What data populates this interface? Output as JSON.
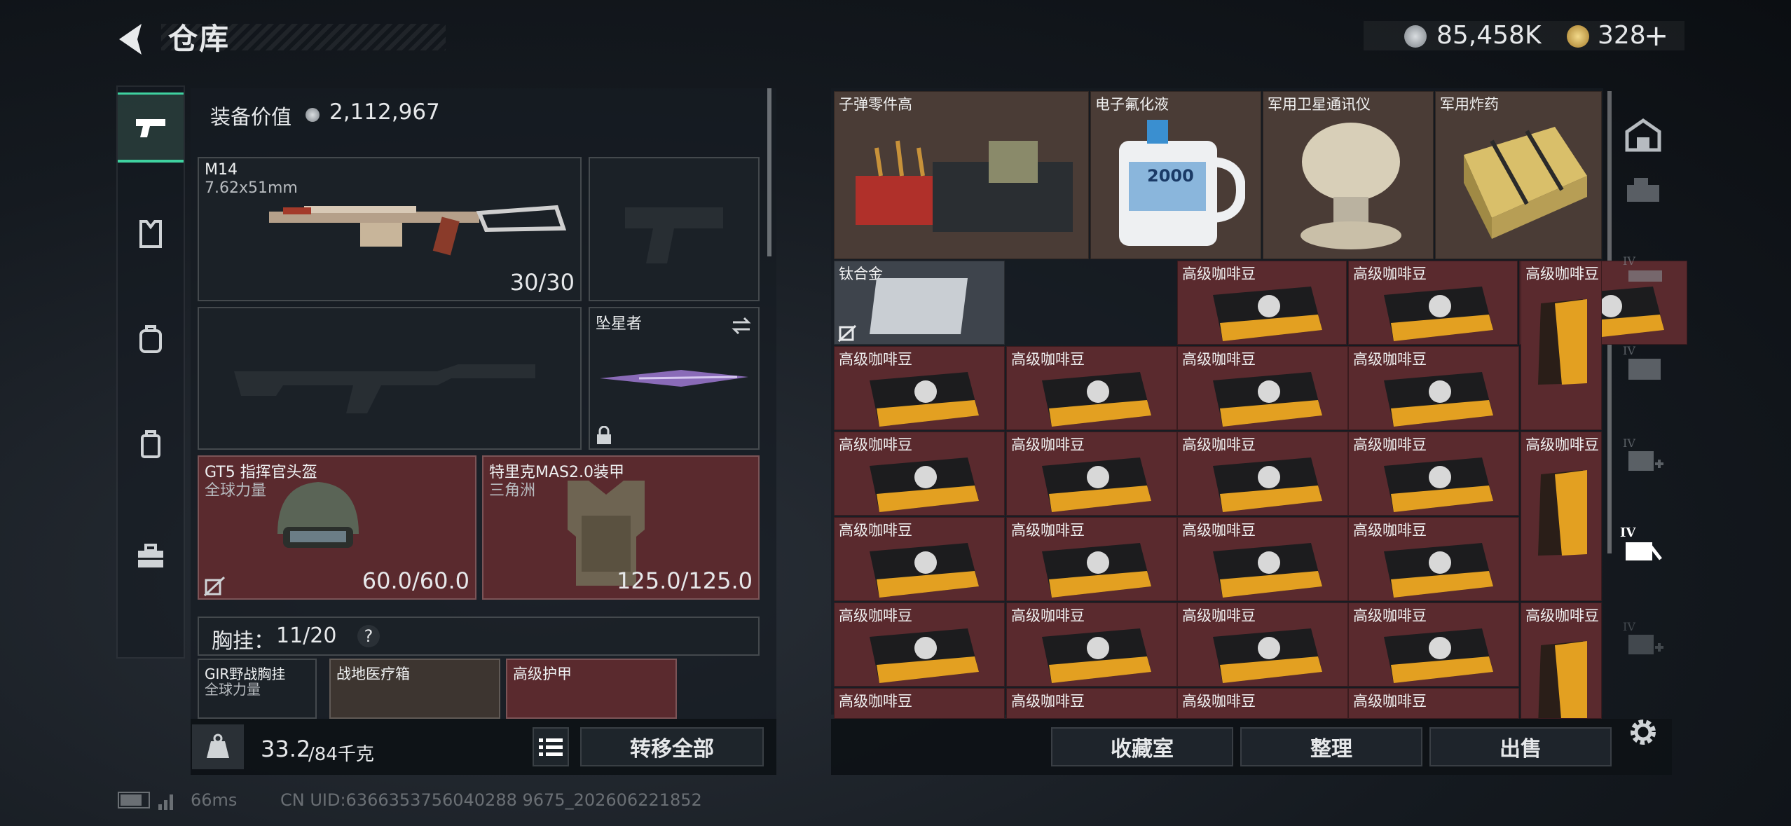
{
  "header": {
    "title": "仓库"
  },
  "currency": {
    "silver": "85,458K",
    "gold": "328",
    "plus": "+"
  },
  "equip": {
    "label": "装备价值",
    "value": "2,112,967"
  },
  "slots": {
    "primary": {
      "name": "M14",
      "caliber": "7.62x51mm",
      "ammo": "30/30"
    },
    "melee": {
      "name": "坠星者"
    },
    "helmet": {
      "name": "GT5 指挥官头盔",
      "sub": "全球力量",
      "durability": "60.0/60.0"
    },
    "armor": {
      "name": "特里克MAS2.0装甲",
      "sub": "三角洲",
      "durability": "125.0/125.0"
    }
  },
  "rig": {
    "label": "胸挂：",
    "count": "11/20",
    "help": "?",
    "items": [
      {
        "name": "GIR野战胸挂",
        "sub": "全球力量"
      },
      {
        "name": "战地医疗箱"
      },
      {
        "name": "高级护甲"
      }
    ]
  },
  "bottom_left": {
    "weight": "33.2",
    "capacity": "/84千克",
    "transfer": "转移全部"
  },
  "stash": {
    "top_row": [
      "子弹零件高",
      "电子氟化液",
      "军用卫星通讯仪",
      "军用炸药"
    ],
    "titanium": "钛合金",
    "coffee": "高级咖啡豆",
    "jug_label": "2000"
  },
  "bottom_right": {
    "collection": "收藏室",
    "sort": "整理",
    "sell": "出售"
  },
  "status": {
    "ping": "66ms",
    "uid": "CN UID:6366353756040288 9675_202606221852"
  },
  "colors": {
    "accent": "#3fd1a0",
    "rare_red": "#5a2a2e"
  }
}
